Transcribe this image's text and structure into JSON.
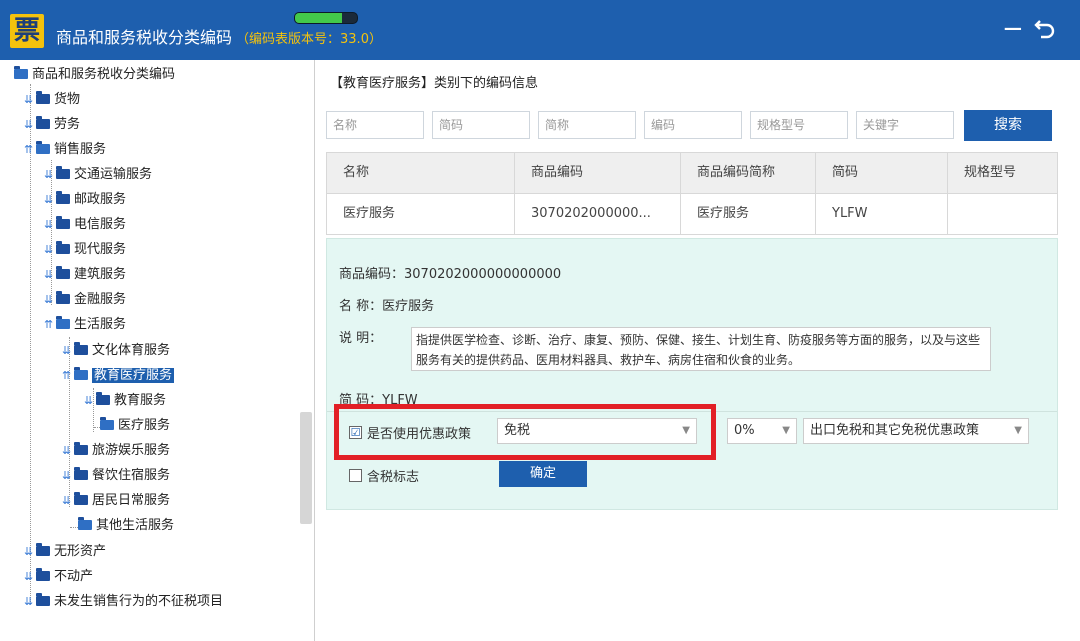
{
  "app": {
    "logo_char": "票",
    "title": "商品和服务税收分类编码",
    "version": "（编码表版本号：33.0）",
    "progress_fraction": 0.75,
    "minimize_glyph": "−",
    "restore_glyph": "⮌"
  },
  "tree": {
    "items": [
      {
        "label": "商品和服务税收分类编码"
      },
      {
        "label": "货物"
      },
      {
        "label": "劳务"
      },
      {
        "label": "销售服务"
      },
      {
        "label": "交通运输服务"
      },
      {
        "label": "邮政服务"
      },
      {
        "label": "电信服务"
      },
      {
        "label": "现代服务"
      },
      {
        "label": "建筑服务"
      },
      {
        "label": "金融服务"
      },
      {
        "label": "生活服务"
      },
      {
        "label": "文化体育服务"
      },
      {
        "label": "教育医疗服务"
      },
      {
        "label": "教育服务"
      },
      {
        "label": "医疗服务"
      },
      {
        "label": "旅游娱乐服务"
      },
      {
        "label": "餐饮住宿服务"
      },
      {
        "label": "居民日常服务"
      },
      {
        "label": "其他生活服务"
      },
      {
        "label": "无形资产"
      },
      {
        "label": "不动产"
      },
      {
        "label": "未发生销售行为的不征税项目"
      }
    ]
  },
  "main": {
    "section_title": "【教育医疗服务】类别下的编码信息",
    "search": {
      "name_placeholder": "名称",
      "shortcode_placeholder": "简码",
      "shortname_placeholder": "简称",
      "code_placeholder": "编码",
      "spec_placeholder": "规格型号",
      "keyword_placeholder": "关键字",
      "button_label": "搜索"
    },
    "table": {
      "headers": [
        "名称",
        "商品编码",
        "商品编码简称",
        "简码",
        "规格型号"
      ],
      "rows": [
        [
          "医疗服务",
          "3070202000000...",
          "医疗服务",
          "YLFW",
          ""
        ]
      ]
    },
    "detail": {
      "code_line": "商品编码：3070202000000000000",
      "name_line": "名    称：医疗服务",
      "desc_label": "说    明：",
      "desc_text": "指提供医学检查、诊断、治疗、康复、预防、保健、接生、计划生育、防疫服务等方面的服务，以及与这些服务有关的提供药品、医用材料器具、救护车、病房住宿和伙食的业务。",
      "shortcode_line": "简    码：YLFW",
      "use_policy_label": "是否使用优惠政策",
      "use_policy_checked": "☑",
      "policy_value": "免税",
      "rate_value": "0%",
      "policy_type_value": "出口免税和其它免税优惠政策",
      "tax_included_label": "含税标志",
      "confirm_label": "确定"
    }
  }
}
